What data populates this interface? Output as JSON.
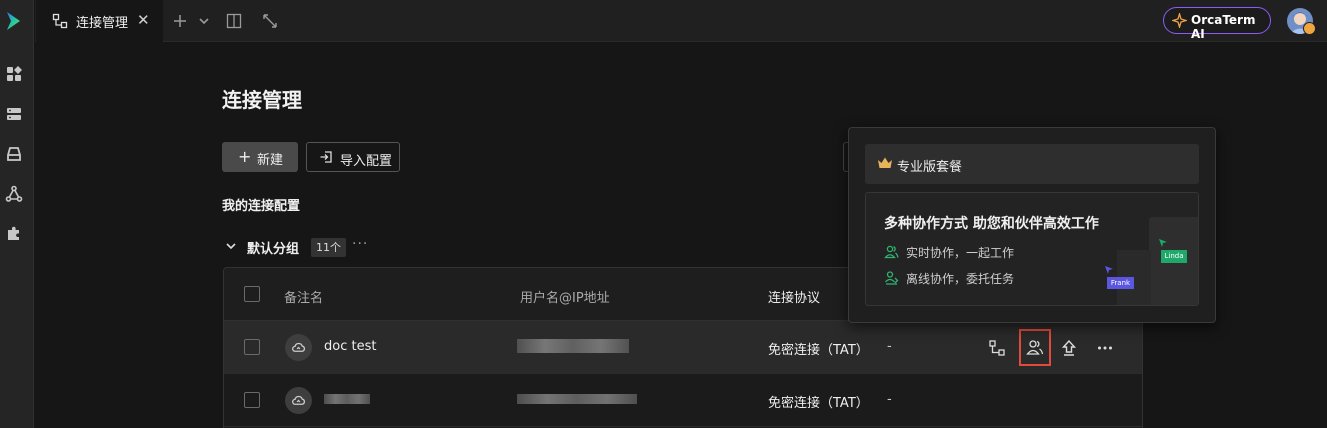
{
  "tabs": [
    {
      "label": "连接管理",
      "close": "✕"
    }
  ],
  "ai_button": {
    "label": "OrcaTerm AI"
  },
  "page": {
    "title": "连接管理"
  },
  "toolbar": {
    "new_label": "新建",
    "new_plus": "+",
    "import_label": "导入配置"
  },
  "section": {
    "title": "我的连接配置"
  },
  "group": {
    "name": "默认分组",
    "count": "11个",
    "more": "···"
  },
  "table": {
    "headers": {
      "remark": "备注名",
      "user_ip": "用户名@IP地址",
      "protocol": "连接协议"
    },
    "rows": [
      {
        "name": "doc test",
        "protocol": "免密连接（TAT）",
        "extra": "-"
      },
      {
        "name": "",
        "protocol": "免密连接（TAT）",
        "extra": "-"
      }
    ]
  },
  "popover": {
    "header": "专业版套餐",
    "title": "多种协作方式 助您和伙伴高效工作",
    "features": [
      "实时协作，一起工作",
      "离线协作，委托任务"
    ],
    "illustration_tags": {
      "linda": "Linda",
      "frank": "Frank"
    }
  },
  "colors": {
    "accent_red": "#e04b3b",
    "ai_border": "#8b5cf6",
    "feature_green": "#2fb36f"
  }
}
